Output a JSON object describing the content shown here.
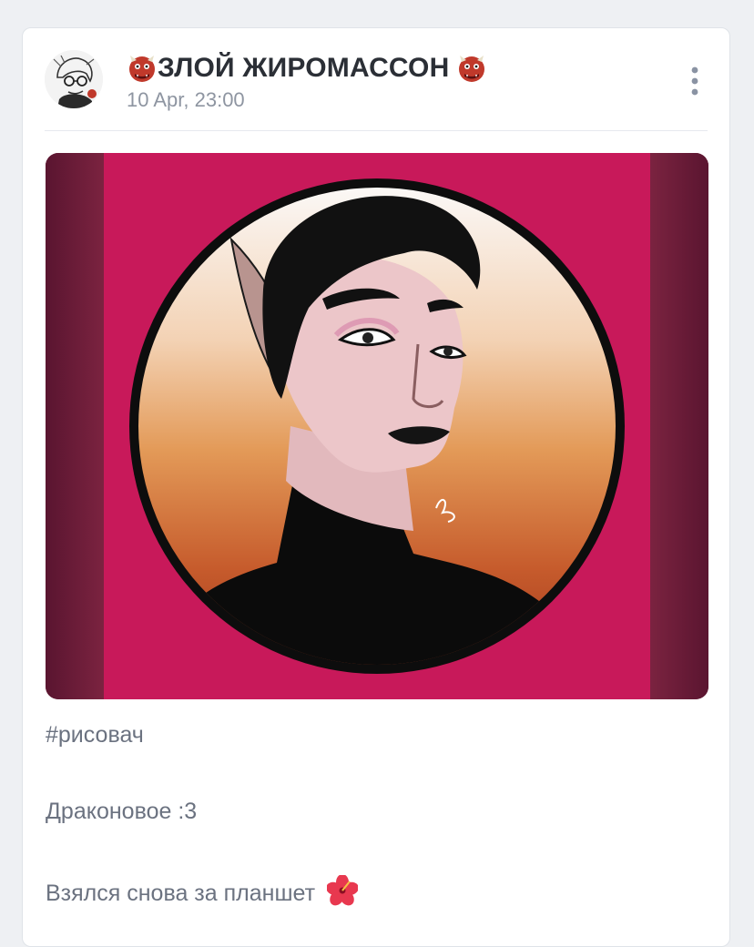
{
  "post": {
    "author_name": "ЗЛОЙ ЖИРОМАССОН",
    "timestamp": "10 Apr, 23:00",
    "hashtag": "#рисовач",
    "text_line_1": "Драконовое :3",
    "text_line_2": "Взялся снова за планшет"
  },
  "icons": {
    "title_left": "ogre-face-icon",
    "title_right": "ogre-face-icon",
    "menu": "vertical-dots-icon",
    "text_end": "hibiscus-icon"
  },
  "colors": {
    "title": "#2b2f36",
    "meta": "#8e95a1",
    "body_text": "#6b7280",
    "artwork_background": "#c8195a"
  }
}
